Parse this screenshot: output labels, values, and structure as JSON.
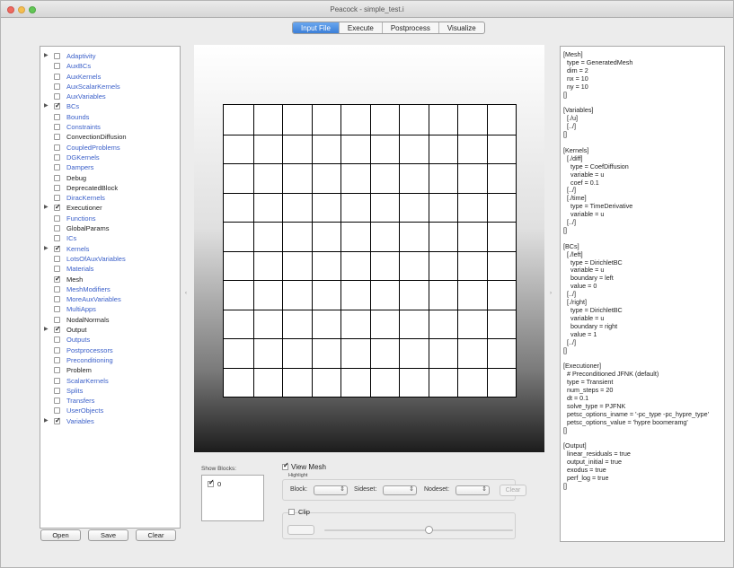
{
  "window": {
    "title": "Peacock - simple_test.i"
  },
  "tabs": [
    {
      "label": "Input File",
      "active": true
    },
    {
      "label": "Execute",
      "active": false
    },
    {
      "label": "Postprocess",
      "active": false
    },
    {
      "label": "Visualize",
      "active": false
    }
  ],
  "tree": {
    "items": [
      {
        "label": "Adaptivity",
        "expandable": true,
        "checked": false,
        "style": "link"
      },
      {
        "label": "AuxBCs",
        "expandable": false,
        "checked": false,
        "style": "link"
      },
      {
        "label": "AuxKernels",
        "expandable": false,
        "checked": false,
        "style": "link"
      },
      {
        "label": "AuxScalarKernels",
        "expandable": false,
        "checked": false,
        "style": "link"
      },
      {
        "label": "AuxVariables",
        "expandable": false,
        "checked": false,
        "style": "link"
      },
      {
        "label": "BCs",
        "expandable": true,
        "checked": true,
        "style": "link"
      },
      {
        "label": "Bounds",
        "expandable": false,
        "checked": false,
        "style": "link"
      },
      {
        "label": "Constraints",
        "expandable": false,
        "checked": false,
        "style": "link"
      },
      {
        "label": "ConvectionDiffusion",
        "expandable": false,
        "checked": false,
        "style": "plain"
      },
      {
        "label": "CoupledProblems",
        "expandable": false,
        "checked": false,
        "style": "link"
      },
      {
        "label": "DGKernels",
        "expandable": false,
        "checked": false,
        "style": "link"
      },
      {
        "label": "Dampers",
        "expandable": false,
        "checked": false,
        "style": "link"
      },
      {
        "label": "Debug",
        "expandable": false,
        "checked": false,
        "style": "plain"
      },
      {
        "label": "DeprecatedBlock",
        "expandable": false,
        "checked": false,
        "style": "plain"
      },
      {
        "label": "DiracKernels",
        "expandable": false,
        "checked": false,
        "style": "link"
      },
      {
        "label": "Executioner",
        "expandable": true,
        "checked": true,
        "style": "plain"
      },
      {
        "label": "Functions",
        "expandable": false,
        "checked": false,
        "style": "link"
      },
      {
        "label": "GlobalParams",
        "expandable": false,
        "checked": false,
        "style": "plain"
      },
      {
        "label": "ICs",
        "expandable": false,
        "checked": false,
        "style": "link"
      },
      {
        "label": "Kernels",
        "expandable": true,
        "checked": true,
        "style": "link"
      },
      {
        "label": "LotsOfAuxVariables",
        "expandable": false,
        "checked": false,
        "style": "link"
      },
      {
        "label": "Materials",
        "expandable": false,
        "checked": false,
        "style": "link"
      },
      {
        "label": "Mesh",
        "expandable": false,
        "checked": true,
        "style": "plain"
      },
      {
        "label": "MeshModifiers",
        "expandable": false,
        "checked": false,
        "style": "link"
      },
      {
        "label": "MoreAuxVariables",
        "expandable": false,
        "checked": false,
        "style": "link"
      },
      {
        "label": "MultiApps",
        "expandable": false,
        "checked": false,
        "style": "link"
      },
      {
        "label": "NodalNormals",
        "expandable": false,
        "checked": false,
        "style": "plain"
      },
      {
        "label": "Output",
        "expandable": true,
        "checked": true,
        "style": "plain"
      },
      {
        "label": "Outputs",
        "expandable": false,
        "checked": false,
        "style": "link"
      },
      {
        "label": "Postprocessors",
        "expandable": false,
        "checked": false,
        "style": "link"
      },
      {
        "label": "Preconditioning",
        "expandable": false,
        "checked": false,
        "style": "link"
      },
      {
        "label": "Problem",
        "expandable": false,
        "checked": false,
        "style": "plain"
      },
      {
        "label": "ScalarKernels",
        "expandable": false,
        "checked": false,
        "style": "link"
      },
      {
        "label": "Splits",
        "expandable": false,
        "checked": false,
        "style": "link"
      },
      {
        "label": "Transfers",
        "expandable": false,
        "checked": false,
        "style": "link"
      },
      {
        "label": "UserObjects",
        "expandable": false,
        "checked": false,
        "style": "link"
      },
      {
        "label": "Variables",
        "expandable": true,
        "checked": true,
        "style": "link"
      }
    ]
  },
  "buttons": {
    "open": "Open",
    "save": "Save",
    "clear": "Clear"
  },
  "mesh": {
    "rows": 10,
    "cols": 10
  },
  "show_blocks": {
    "label": "Show Blocks:",
    "items": [
      "0"
    ]
  },
  "view_mesh": {
    "label": "View Mesh",
    "checked": true
  },
  "highlight": {
    "label": "Highlight",
    "block_label": "Block:",
    "sideset_label": "Sideset:",
    "nodeset_label": "Nodeset:",
    "clear_label": "Clear"
  },
  "clip": {
    "label": "Clip",
    "checked": false
  },
  "editor": {
    "text": "[Mesh]\n  type = GeneratedMesh\n  dim = 2\n  nx = 10\n  ny = 10\n[]\n\n[Variables]\n  [./u]\n  [../]\n[]\n\n[Kernels]\n  [./diff]\n    type = CoefDiffusion\n    variable = u\n    coef = 0.1\n  [../]\n  [./time]\n    type = TimeDerivative\n    variable = u\n  [../]\n[]\n\n[BCs]\n  [./left]\n    type = DirichletBC\n    variable = u\n    boundary = left\n    value = 0\n  [../]\n  [./right]\n    type = DirichletBC\n    variable = u\n    boundary = right\n    value = 1\n  [../]\n[]\n\n[Executioner]\n  # Preconditioned JFNK (default)\n  type = Transient\n  num_steps = 20\n  dt = 0.1\n  solve_type = PJFNK\n  petsc_options_iname = '-pc_type -pc_hypre_type'\n  petsc_options_value = 'hypre boomeramg'\n[]\n\n[Output]\n  linear_residuals = true\n  output_initial = true\n  exodus = true\n  perf_log = true\n[]"
  }
}
